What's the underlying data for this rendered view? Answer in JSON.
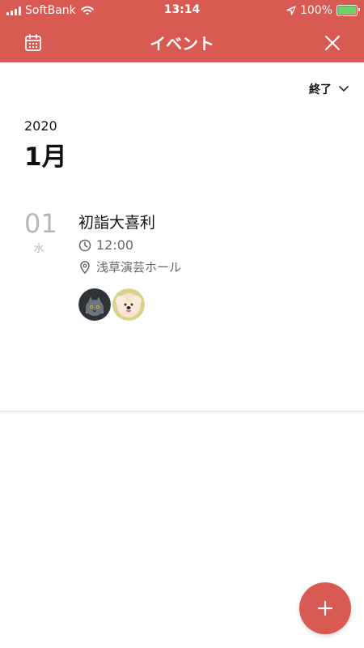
{
  "status_bar": {
    "carrier": "SoftBank",
    "time": "13:14",
    "battery_percent": "100%",
    "signal_icon": "signal-bars-icon",
    "wifi_icon": "wifi-icon",
    "location_icon": "location-arrow-icon",
    "battery_icon": "battery-charging-icon"
  },
  "header": {
    "title": "イベント",
    "left_icon": "calendar-icon",
    "right_icon": "close-icon",
    "background_color": "#d85a52"
  },
  "filter": {
    "selected_label": "終了",
    "icon": "chevron-down-icon"
  },
  "period": {
    "year": "2020",
    "month": "1月"
  },
  "events": [
    {
      "day": "01",
      "weekday": "水",
      "title": "初詣大喜利",
      "time": "12:00",
      "location": "浅草演芸ホール",
      "time_icon": "clock-icon",
      "location_icon": "location-pin-icon",
      "attendee_avatars": [
        "cat-avatar",
        "dog-avatar"
      ]
    }
  ],
  "actions": {
    "add_icon": "plus-icon"
  },
  "theme": {
    "accent": "#d85a52",
    "muted_text": "#666666",
    "date_text": "#b7b7b7"
  }
}
